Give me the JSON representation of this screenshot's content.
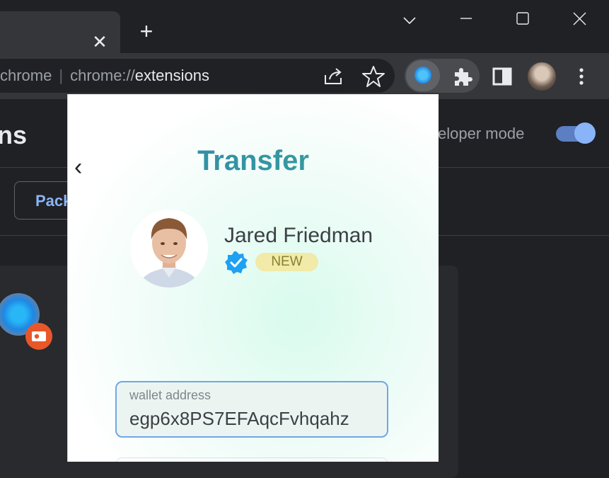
{
  "browser": {
    "tab_close_icon": "close-icon",
    "new_tab_label": "+",
    "window_controls": [
      "chevron-down-icon",
      "minimize-icon",
      "maximize-icon",
      "close-icon"
    ],
    "address_bar": {
      "scheme_text": "chrome",
      "url_prefix": "chrome://",
      "url_host": "extensions"
    },
    "toolbar_icons": [
      "share-icon",
      "star-icon",
      "extension-active-icon",
      "puzzle-icon",
      "side-panel-icon",
      "profile-avatar",
      "more-vert-icon"
    ]
  },
  "page": {
    "title_fragment": "ns",
    "developer_mode_label": "veloper mode",
    "developer_mode_on": true,
    "pack_button_label": "Pack",
    "accent_color": "#8ab4f8"
  },
  "popup": {
    "back_glyph": "‹",
    "title": "Transfer",
    "contact": {
      "name": "Jared Friedman",
      "badge": "NEW",
      "verified": true
    },
    "wallet": {
      "label": "wallet address",
      "value": "egp6x8PS7EFAqcFvhqahz"
    },
    "colors": {
      "title_gradient_start": "#2e86ab",
      "title_gradient_end": "#3aa39b",
      "field_border": "#6ea8e6",
      "badge_bg": "#f1eaa8",
      "verified_blue": "#1da1f2"
    }
  }
}
